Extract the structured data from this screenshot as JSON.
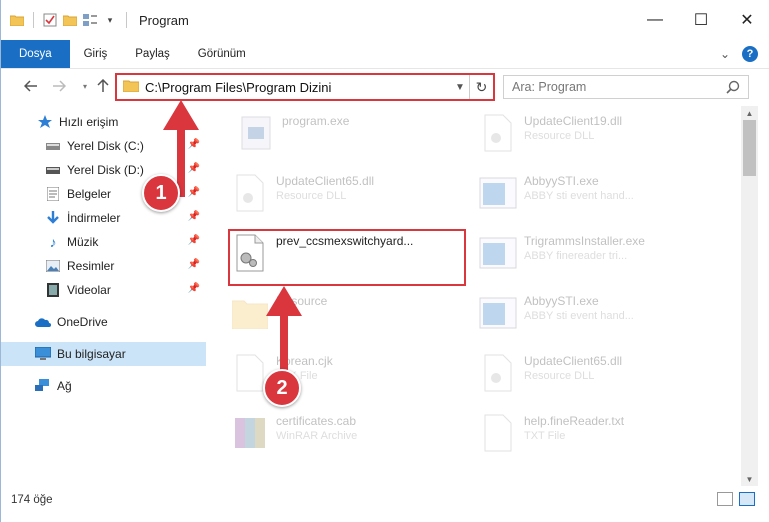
{
  "window": {
    "title": "Program",
    "controls": {
      "minimize": "—",
      "maximize": "☐",
      "close": "✕"
    }
  },
  "ribbon": {
    "tabs": [
      "Dosya",
      "Giriş",
      "Paylaş",
      "Görünüm"
    ],
    "expand": "⌄",
    "help": "?"
  },
  "address": {
    "path": "C:\\Program Files\\Program Dizini",
    "search_placeholder": "Ara: Program"
  },
  "sidebar": {
    "items": [
      {
        "label": "Hızlı erişim",
        "icon": "star-icon"
      },
      {
        "label": "Yerel Disk (C:)",
        "icon": "drive-icon",
        "pinned": true
      },
      {
        "label": "Yerel Disk (D:)",
        "icon": "drive-icon",
        "pinned": true
      },
      {
        "label": "Belgeler",
        "icon": "documents-icon",
        "pinned": true
      },
      {
        "label": "İndirmeler",
        "icon": "download-icon",
        "pinned": true
      },
      {
        "label": "Müzik",
        "icon": "music-icon",
        "pinned": true
      },
      {
        "label": "Resimler",
        "icon": "pictures-icon",
        "pinned": true
      },
      {
        "label": "Videolar",
        "icon": "video-icon",
        "pinned": true
      },
      {
        "label": "OneDrive",
        "icon": "cloud-icon"
      },
      {
        "label": "Bu bilgisayar",
        "icon": "computer-icon",
        "selected": true
      },
      {
        "label": "Ağ",
        "icon": "network-icon"
      }
    ]
  },
  "files": [
    {
      "name": "program.exe",
      "desc": "",
      "icon": "exe-icon"
    },
    {
      "name": "UpdateClient65.dll",
      "desc": "Resource DLL",
      "icon": "dll-icon"
    },
    {
      "name": "prev_ccsmexswitchyard...",
      "desc": "",
      "icon": "dll-icon",
      "highlighted": true
    },
    {
      "name": "Resource",
      "desc": "",
      "icon": "folder-icon"
    },
    {
      "name": "Korean.cjk",
      "desc": "CJK File",
      "icon": "file-icon"
    },
    {
      "name": "certificates.cab",
      "desc": "WinRAR Archive",
      "icon": "archive-icon"
    },
    {
      "name": "UpdateClient19.dll",
      "desc": "Resource DLL",
      "icon": "dll-icon"
    },
    {
      "name": "AbbyySTI.exe",
      "desc": "ABBY sti event hand...",
      "icon": "app-icon"
    },
    {
      "name": "TrigrammsInstaller.exe",
      "desc": "ABBY finereader tri...",
      "icon": "app-icon"
    },
    {
      "name": "AbbyySTI.exe",
      "desc": "ABBY sti event hand...",
      "icon": "app-icon"
    },
    {
      "name": "UpdateClient65.dll",
      "desc": "Resource DLL",
      "icon": "dll-icon"
    },
    {
      "name": "help.fineReader.txt",
      "desc": "TXT File",
      "icon": "file-icon"
    }
  ],
  "annotations": {
    "step1": "1",
    "step2": "2"
  },
  "status": {
    "count": "174 öğe"
  },
  "colors": {
    "accent": "#1a6fc4",
    "highlight": "#d9363e"
  }
}
